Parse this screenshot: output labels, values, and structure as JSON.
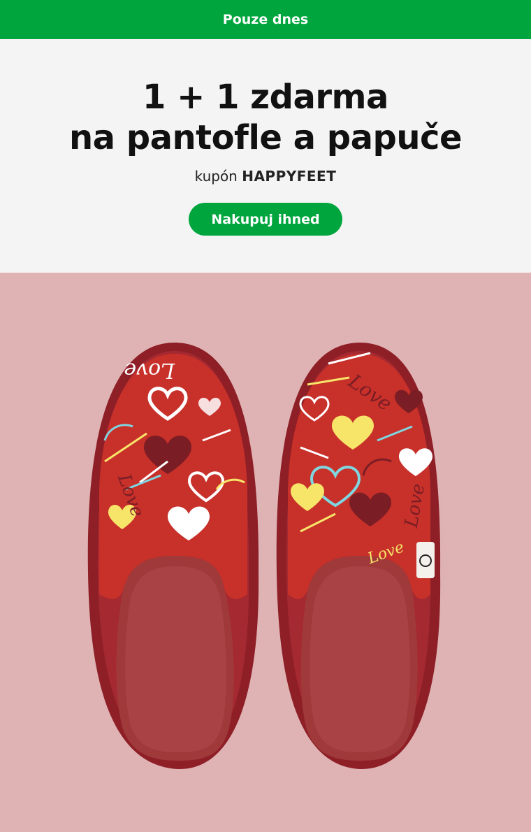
{
  "banner": {
    "label": "Pouze dnes"
  },
  "hero": {
    "headline_line1": "1 + 1 zdarma",
    "headline_line2": "na pantofle a papuče",
    "coupon_prefix": "kupón",
    "coupon_code": "HAPPYFEET",
    "cta_label": "Nakupuj ihned"
  },
  "product": {
    "image_alt": "Červené pantofle se vzorem srdíček a nápisem Love",
    "print_text": "Love"
  },
  "colors": {
    "accent": "#00a63d",
    "hero_bg": "#f4f4f4",
    "product_bg": "#dfb3b4",
    "slipper_red": "#c8302a",
    "sole": "#9e3537"
  }
}
